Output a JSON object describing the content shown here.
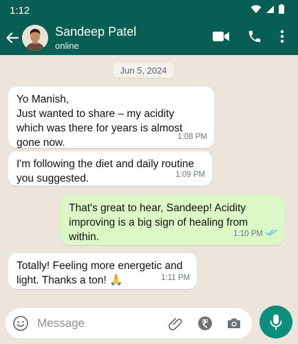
{
  "status_bar": {
    "time": "1:12"
  },
  "contact": {
    "name": "Sandeep Patel",
    "status": "online"
  },
  "chat": {
    "date": "Jun 5, 2024",
    "messages": [
      {
        "direction": "in",
        "text": "Yo Manish,\nJust wanted to share – my acidity\nwhich was there for years is almost\ngone now.",
        "time": "1:08 PM"
      },
      {
        "direction": "in",
        "text": "I'm following the diet and daily routine\nyou suggested.",
        "time": "1:09 PM"
      },
      {
        "direction": "out",
        "text": "That's great to hear, Sandeep! Acidity\nimproving is a big sign of healing from\nwithin.",
        "time": "1:10 PM",
        "read": true
      },
      {
        "direction": "in",
        "text": "Totally! Feeling more energetic and\nlight. Thanks a ton! 🙏",
        "time": "1:11 PM"
      }
    ]
  },
  "composer": {
    "placeholder": "Message"
  },
  "colors": {
    "header": "#075e54",
    "outgoing_bubble": "#dcf8c6",
    "incoming_bubble": "#ffffff",
    "read_ticks": "#53bdeb",
    "mic_button": "#0e8f7e"
  },
  "icons": [
    "back-arrow-icon",
    "video-call-icon",
    "phone-icon",
    "more-options-icon",
    "emoji-icon",
    "attach-icon",
    "rupee-payment-icon",
    "camera-icon",
    "mic-icon",
    "double-tick-icon",
    "wifi-icon",
    "signal-icon",
    "battery-icon"
  ]
}
